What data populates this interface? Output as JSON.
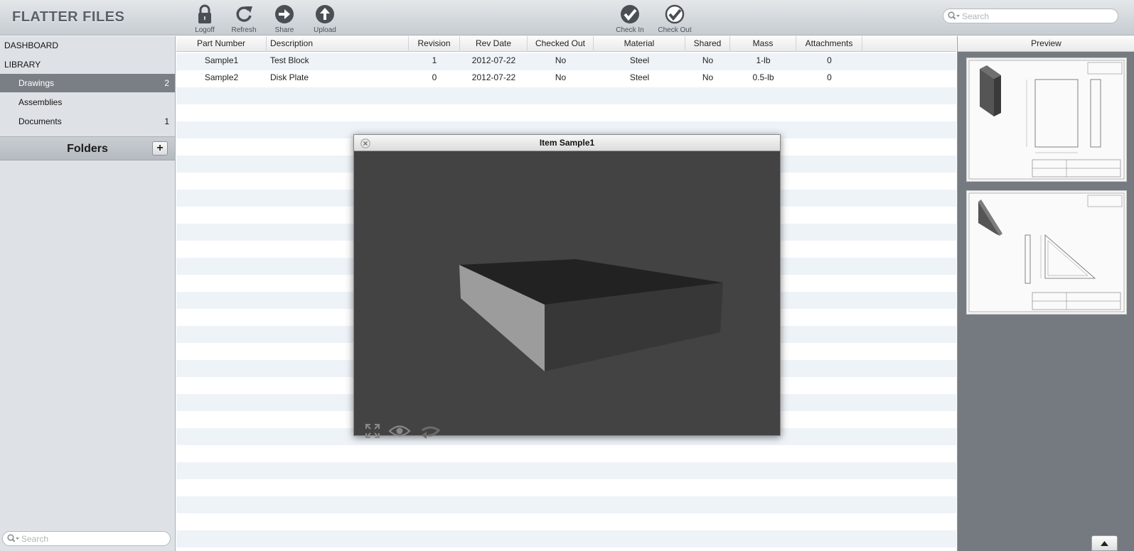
{
  "app": {
    "title": "FLATTER FILES"
  },
  "toolbar": {
    "buttons": [
      {
        "label": "Logoff",
        "icon": "lock-icon"
      },
      {
        "label": "Refresh",
        "icon": "refresh-icon"
      },
      {
        "label": "Share",
        "icon": "share-arrow-icon"
      },
      {
        "label": "Upload",
        "icon": "upload-icon"
      },
      {
        "label": "Check In",
        "icon": "check-in-icon"
      },
      {
        "label": "Check Out",
        "icon": "check-out-icon"
      }
    ],
    "search_placeholder": "Search"
  },
  "sidebar": {
    "dashboard": "DASHBOARD",
    "library": "LIBRARY",
    "items": [
      {
        "label": "Drawings",
        "count": "2",
        "active": true
      },
      {
        "label": "Assemblies",
        "count": ""
      },
      {
        "label": "Documents",
        "count": "1"
      }
    ],
    "folders_title": "Folders",
    "folders_add": "+",
    "search_placeholder": "Search"
  },
  "table": {
    "columns": [
      "Part Number",
      "Description",
      "Revision",
      "Rev Date",
      "Checked Out",
      "Material",
      "Shared",
      "Mass",
      "Attachments"
    ],
    "rows": [
      [
        "Sample1",
        "Test Block",
        "1",
        "2012-07-22",
        "No",
        "Steel",
        "No",
        "1-lb",
        "0"
      ],
      [
        "Sample2",
        "Disk Plate",
        "0",
        "2012-07-22",
        "No",
        "Steel",
        "No",
        "0.5-lb",
        "0"
      ]
    ]
  },
  "preview": {
    "title": "Preview",
    "scroll_top_icon": "triangle-up-icon"
  },
  "viewer": {
    "title": "Item Sample1",
    "controls": [
      "fullscreen-icon",
      "eye-icon",
      "rotate-icon"
    ]
  },
  "colors": {
    "toolbar_top": "#e4e7ea",
    "toolbar_bottom": "#c6ccd2",
    "sidebar": "#dee2e6",
    "active_item": "#7a7f85",
    "viewer_bg": "#434343"
  }
}
